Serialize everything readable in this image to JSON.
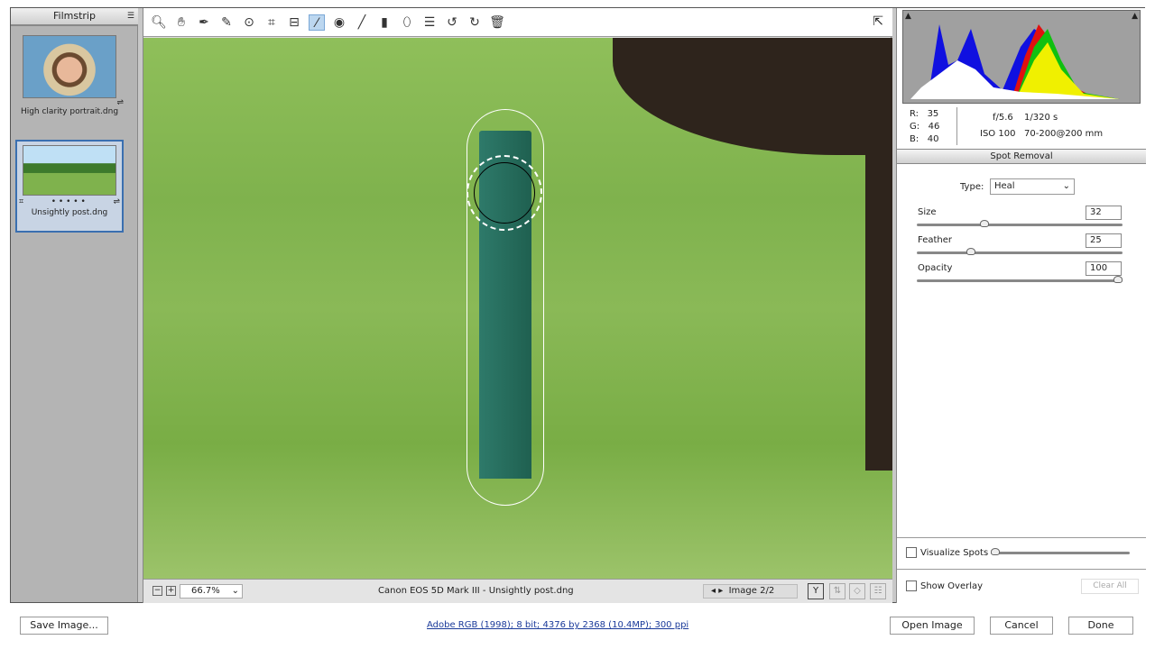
{
  "filmstrip": {
    "title": "Filmstrip",
    "items": [
      {
        "label": "High clarity portrait.dng"
      },
      {
        "label": "Unsightly post.dng",
        "rating": "• • • • •",
        "selected": true
      }
    ]
  },
  "toolbar": {
    "tools": [
      "zoom-icon",
      "hand-icon",
      "white-balance-icon",
      "color-sampler-icon",
      "targeted-adjustment-icon",
      "crop-icon",
      "straighten-icon",
      "spot-removal-icon",
      "red-eye-icon",
      "adjustment-brush-icon",
      "graduated-filter-icon",
      "radial-filter-icon",
      "presets-icon",
      "rotate-left-icon",
      "rotate-right-icon",
      "trash-icon"
    ],
    "active": "spot-removal-icon"
  },
  "statusbar": {
    "zoom": "66.7%",
    "filename": "Canon EOS 5D Mark III  -  Unsightly post.dng",
    "image_counter": "Image 2/2"
  },
  "info": {
    "r_label": "R:",
    "r": "35",
    "g_label": "G:",
    "g": "46",
    "b_label": "B:",
    "b": "40",
    "aperture": "f/5.6",
    "shutter": "1/320 s",
    "iso": "ISO 100",
    "lens": "70-200@200 mm"
  },
  "spot_removal": {
    "title": "Spot Removal",
    "type_label": "Type:",
    "type_value": "Heal",
    "size_label": "Size",
    "size": "32",
    "size_pct": 32,
    "feather_label": "Feather",
    "feather": "25",
    "feather_pct": 25,
    "opacity_label": "Opacity",
    "opacity": "100",
    "opacity_pct": 100,
    "visualize_label": "Visualize Spots",
    "overlay_label": "Show Overlay",
    "clear_all": "Clear All"
  },
  "footer": {
    "save": "Save Image...",
    "workflow": "Adobe RGB (1998); 8 bit; 4376 by 2368 (10.4MP); 300 ppi",
    "open": "Open Image",
    "cancel": "Cancel",
    "done": "Done"
  }
}
